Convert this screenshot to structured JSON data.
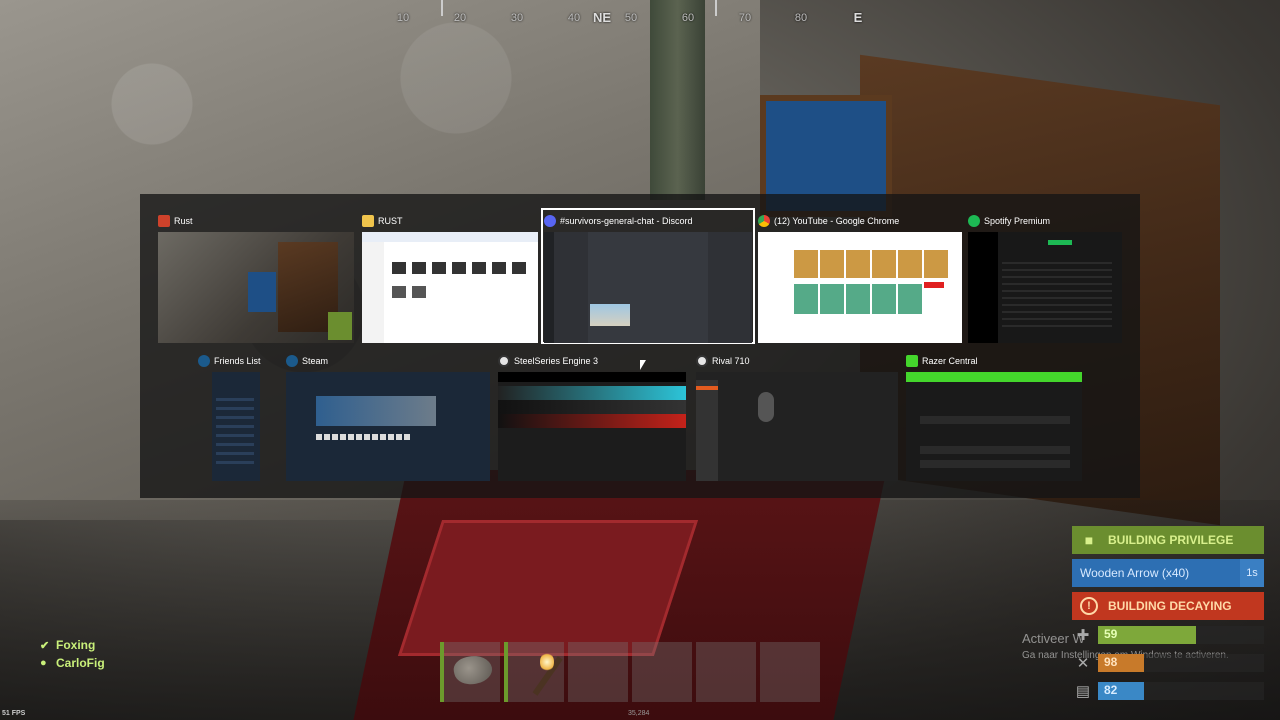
{
  "compass": {
    "ticks": [
      "10",
      "20",
      "30",
      "40",
      "NE",
      "50",
      "60",
      "70",
      "80",
      "E"
    ]
  },
  "switcher": {
    "windows_row1": [
      {
        "title": "Rust",
        "icon": "rust-icon"
      },
      {
        "title": "RUST",
        "icon": "folder-icon"
      },
      {
        "title": "#survivors-general-chat - Discord",
        "icon": "discord-icon",
        "selected": true
      },
      {
        "title": "(12) YouTube - Google Chrome",
        "icon": "chrome-icon"
      },
      {
        "title": "Spotify Premium",
        "icon": "spotify-icon"
      }
    ],
    "windows_row2": [
      {
        "title": "Friends List",
        "icon": "steam-icon"
      },
      {
        "title": "Steam",
        "icon": "steam-icon"
      },
      {
        "title": "SteelSeries Engine 3",
        "icon": "steelseries-icon"
      },
      {
        "title": "Rival 710",
        "icon": "steelseries-icon"
      },
      {
        "title": "Razer Central",
        "icon": "razer-icon"
      }
    ]
  },
  "hud": {
    "building_privilege": "BUILDING PRIVILEGE",
    "crafting_item": "Wooden Arrow (x40)",
    "crafting_time": "1s",
    "building_decaying": "BUILDING DECAYING",
    "health": 59,
    "food": 98,
    "water": 82,
    "health_fraction": 0.59,
    "food_fraction": 0.28,
    "water_fraction": 0.28
  },
  "watermark": {
    "line1": "Activeer W",
    "line2": "Ga naar Instellingen om Windows te activeren."
  },
  "team": {
    "members": [
      "Foxing",
      "CarloFig"
    ]
  },
  "fps": "51 FPS",
  "hotbar_label": "35,284"
}
